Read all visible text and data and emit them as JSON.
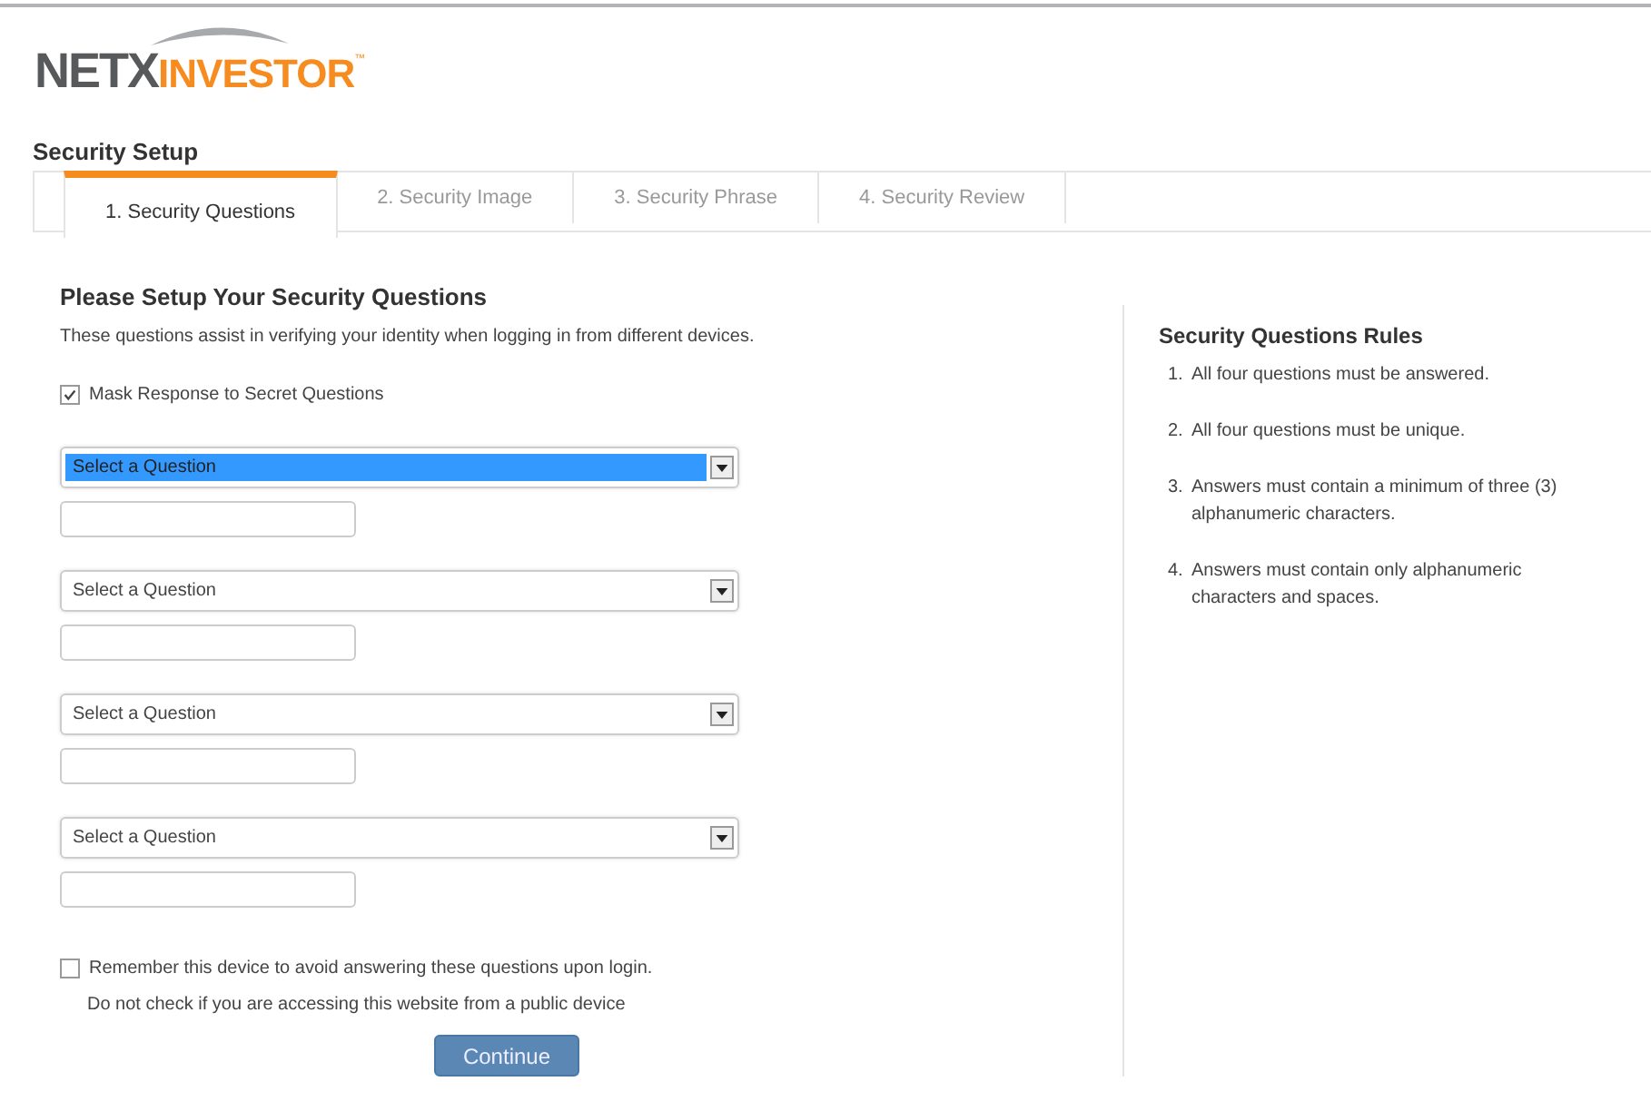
{
  "logo": {
    "part_1": "NETX",
    "part_2": "INVESTOR",
    "trademark": "™"
  },
  "page_title": "Security Setup",
  "tabs": [
    {
      "label": "1. Security Questions",
      "selected": true
    },
    {
      "label": "2. Security Image",
      "selected": false
    },
    {
      "label": "3. Security Phrase",
      "selected": false
    },
    {
      "label": "4. Security Review",
      "selected": false
    }
  ],
  "form": {
    "heading": "Please Setup Your Security Questions",
    "description": "These questions assist in verifying your identity when logging in from different devices.",
    "mask": {
      "label": "Mask Response to Secret Questions",
      "checked": true
    },
    "questions": [
      {
        "select": "Select a Question",
        "focused": true
      },
      {
        "select": "Select a Question",
        "focused": false
      },
      {
        "select": "Select a Question",
        "focused": false
      },
      {
        "select": "Select a Question",
        "focused": false
      }
    ],
    "remember": {
      "label": "Remember this device to avoid answering these questions upon login.",
      "checked": false,
      "note": "Do not check if you are accessing this website from a public device"
    },
    "button": "Continue"
  },
  "rules": {
    "heading": "Security Questions Rules",
    "items": [
      {
        "number": "1.",
        "text": "All four questions must be answered."
      },
      {
        "number": "2.",
        "text": "All four questions must be unique."
      },
      {
        "number": "3.",
        "text": "Answers must contain a minimum of three (3) alphanumeric characters."
      },
      {
        "number": "4.",
        "text": "Answers must contain only alphanumeric characters and spaces."
      }
    ]
  }
}
